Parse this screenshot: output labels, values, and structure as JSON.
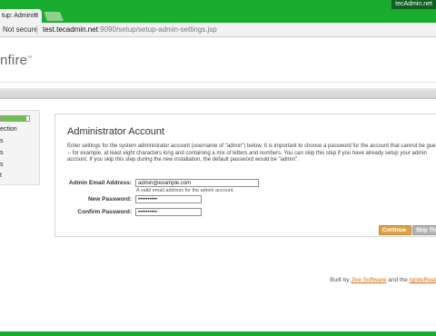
{
  "browser": {
    "tab_title": "tup: Administ",
    "tab_close": "×",
    "user_badge": "tecAdmin.net",
    "not_secure": "Not secure",
    "url_host": "test.tecadmin.net",
    "url_rest": ":9090/setup/setup-admin-settings.jsp"
  },
  "header": {
    "logo_text": "nfire",
    "logo_mark": "™"
  },
  "sidebar": {
    "progress_fraction": 0.9,
    "items": [
      "ection",
      "s",
      "s",
      "s",
      "t"
    ]
  },
  "panel": {
    "title": "Administrator Account",
    "description": "Enter settings for the system administrator account (username of \"admin\") below. It is important to choose a password for the account that cannot be guessed -- for example, at least eight characters long and containing a mix of letters and numbers. You can skip this step if you have already setup your admin account. If you skip this step during the new installation, the default password would be \"admin\".",
    "email_label": "Admin Email Address:",
    "email_value": "admin@example.com",
    "email_hint": "A valid email address for the admin account.",
    "new_password_label": "New Password:",
    "new_password_value": "••••••••••",
    "confirm_password_label": "Confirm Password:",
    "confirm_password_value": "••••••••••",
    "continue_label": "Continue",
    "skip_label": "Skip Th"
  },
  "footer": {
    "prefix": "Built by ",
    "link1": "Jive Software",
    "middle": " and the ",
    "link2": "IgniteReal"
  },
  "colors": {
    "chrome_green": "#19ac2e",
    "continue_button": "#d9a44a",
    "skip_button": "#b3b3b3",
    "progress_fill": "#6cc34a",
    "footer_link": "#d46a12"
  }
}
